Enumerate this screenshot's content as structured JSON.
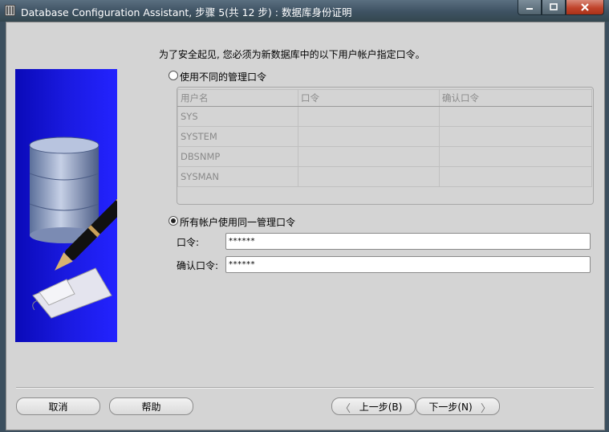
{
  "window": {
    "title": "Database Configuration Assistant, 步骤 5(共 12 步) : 数据库身份证明"
  },
  "main": {
    "prompt": "为了安全起见, 您必须为新数据库中的以下用户帐户指定口令。",
    "option_different": {
      "label": "使用不同的管理口令",
      "checked": false
    },
    "table": {
      "headers": [
        "用户名",
        "口令",
        "确认口令"
      ],
      "rows": [
        {
          "user": "SYS",
          "password": "",
          "confirm": ""
        },
        {
          "user": "SYSTEM",
          "password": "",
          "confirm": ""
        },
        {
          "user": "DBSNMP",
          "password": "",
          "confirm": ""
        },
        {
          "user": "SYSMAN",
          "password": "",
          "confirm": ""
        }
      ]
    },
    "option_same": {
      "label": "所有帐户使用同一管理口令",
      "checked": true
    },
    "password_label": "口令:",
    "password_value": "******",
    "confirm_label": "确认口令:",
    "confirm_value": "******"
  },
  "buttons": {
    "cancel": "取消",
    "help": "帮助",
    "back": "上一步(B)",
    "next": "下一步(N)"
  },
  "colors": {
    "accent_blue": "#1a1ae0",
    "window_bg": "#d4d4d4",
    "titlebar": "#3e5262",
    "close_button": "#c0432b"
  }
}
